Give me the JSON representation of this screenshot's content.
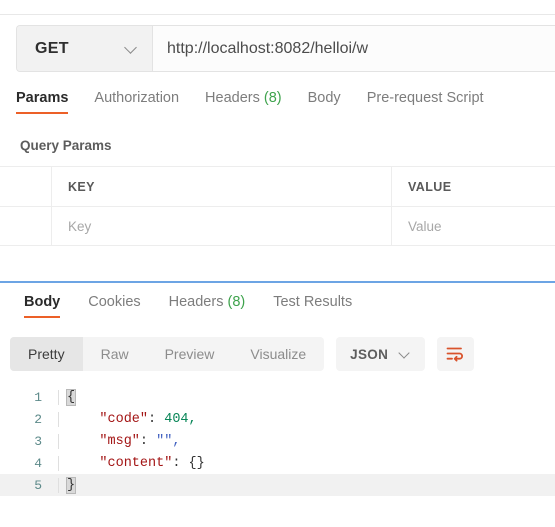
{
  "request": {
    "method": "GET",
    "method_dropdown_icon": "chevron-down-icon",
    "url": "http://localhost:8082/helloi/w",
    "url_placeholder": "Enter request URL",
    "tabs": [
      {
        "label": "Params",
        "active": true
      },
      {
        "label": "Authorization",
        "active": false
      },
      {
        "label": "Headers",
        "count": "(8)",
        "active": false
      },
      {
        "label": "Body",
        "active": false
      },
      {
        "label": "Pre-request Script",
        "active": false
      }
    ],
    "query_params": {
      "title": "Query Params",
      "columns": [
        "KEY",
        "VALUE"
      ],
      "rows": [
        {
          "key_placeholder": "Key",
          "value_placeholder": "Value"
        }
      ]
    }
  },
  "response": {
    "tabs": [
      {
        "label": "Body",
        "active": true
      },
      {
        "label": "Cookies",
        "active": false
      },
      {
        "label": "Headers",
        "count": "(8)",
        "active": false
      },
      {
        "label": "Test Results",
        "active": false
      }
    ],
    "format_modes": [
      {
        "label": "Pretty",
        "active": true
      },
      {
        "label": "Raw",
        "active": false
      },
      {
        "label": "Preview",
        "active": false
      },
      {
        "label": "Visualize",
        "active": false
      }
    ],
    "language": "JSON",
    "language_dropdown_icon": "chevron-down-icon",
    "wrap_lines_icon": "wrap-lines-icon",
    "body": {
      "line_numbers": [
        "1",
        "2",
        "3",
        "4",
        "5"
      ],
      "lines": [
        {
          "open_brace": "{"
        },
        {
          "key": "\"code\"",
          "colon": ": ",
          "num": "404",
          "comma": ","
        },
        {
          "key": "\"msg\"",
          "colon": ": ",
          "str": "\"\"",
          "comma": ","
        },
        {
          "key": "\"content\"",
          "colon": ": ",
          "obj": "{}"
        },
        {
          "close_brace": "}"
        }
      ]
    }
  },
  "colors": {
    "accent": "#ec6028",
    "count_green": "#3fa34d",
    "divider_blue": "#6ca4e4",
    "json_key": "#a31515",
    "json_number": "#098658",
    "json_string": "#4060c0"
  }
}
